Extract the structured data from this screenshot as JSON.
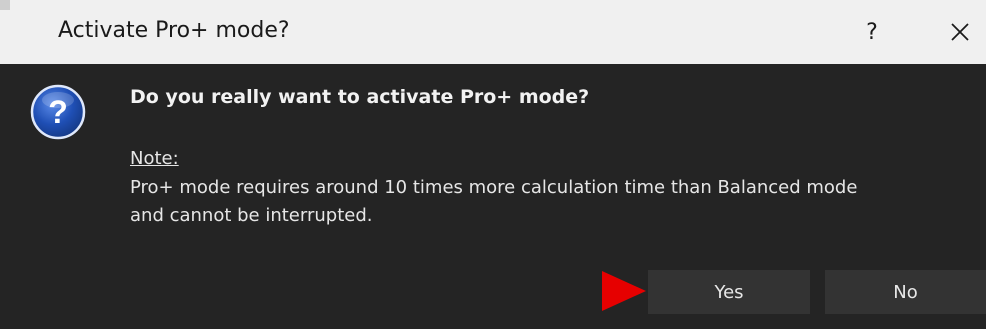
{
  "dialog": {
    "title": "Activate Pro+ mode?",
    "help_label": "?",
    "close_icon": "close-icon",
    "question_icon": "question-icon",
    "question": "Do you really want to activate Pro+ mode?",
    "note_label": "Note:",
    "note_lines": [
      "Pro+ mode requires around 10 times more calculation time than Balanced mode",
      "and cannot be interrupted."
    ],
    "buttons": {
      "yes": "Yes",
      "no": "No"
    },
    "pointer_icon": "red-arrow-pointer-icon"
  },
  "colors": {
    "titlebar_bg": "#f0f0f0",
    "body_bg": "#242424",
    "button_bg": "#333333",
    "icon_blue": "#1f4fb5",
    "pointer_red": "#e60000"
  }
}
